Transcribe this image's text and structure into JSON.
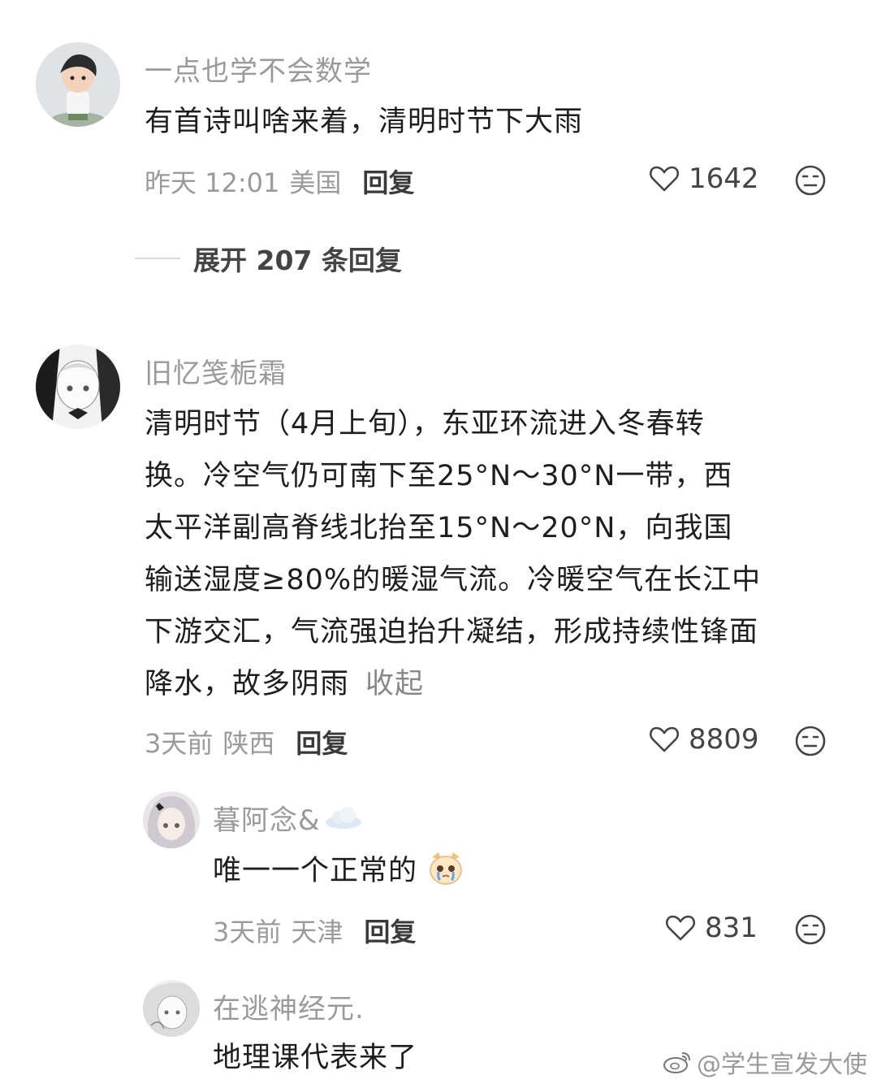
{
  "comments": [
    {
      "username": "一点也学不会数学",
      "text": "有首诗叫啥来着，清明时节下大雨",
      "time": "昨天 12:01",
      "location": "美国",
      "reply_label": "回复",
      "likes": "1642",
      "expand_label": "展开 207 条回复"
    },
    {
      "username": "旧忆笺栀霜",
      "text_lines": [
        "清明时节（4月上旬），东亚环流进入冬春转",
        "换。冷空气仍可南下至25°N～30°N一带，西",
        "太平洋副高脊线北抬至15°N～20°N，向我国",
        "输送湿度≥80%的暖湿气流。冷暖空气在长江中",
        "下游交汇，气流强迫抬升凝结，形成持续性锋面",
        "降水，故多阴雨"
      ],
      "collapse_label": "收起",
      "time": "3天前",
      "location": "陕西",
      "reply_label": "回复",
      "likes": "8809"
    }
  ],
  "replies": [
    {
      "username": "暮阿念&",
      "text": "唯一一个正常的",
      "time": "3天前",
      "location": "天津",
      "reply_label": "回复",
      "likes": "831"
    },
    {
      "username": "在逃神经元.",
      "text": "地理课代表来了"
    }
  ],
  "watermark": "@学生宣发大使",
  "icons": {
    "like": "heart-outline-icon",
    "dislike": "neutral-face-icon",
    "weibo": "weibo-logo-icon"
  }
}
